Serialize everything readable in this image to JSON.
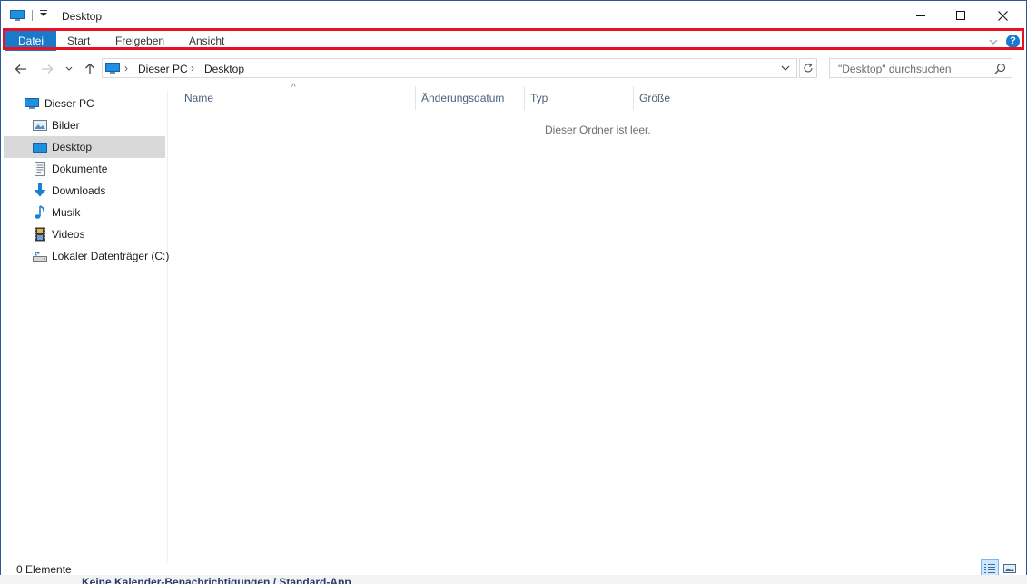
{
  "window": {
    "title": "Desktop"
  },
  "ribbon": {
    "tabs": [
      {
        "label": "Datei",
        "active": true
      },
      {
        "label": "Start"
      },
      {
        "label": "Freigeben"
      },
      {
        "label": "Ansicht"
      }
    ],
    "help_label": "?"
  },
  "navbar": {
    "breadcrumb": [
      "Dieser PC",
      "Desktop"
    ],
    "search_placeholder": "\"Desktop\" durchsuchen"
  },
  "sidebar": {
    "items": [
      {
        "label": "Dieser PC",
        "icon": "pc-icon"
      },
      {
        "label": "Bilder",
        "icon": "pictures-icon"
      },
      {
        "label": "Desktop",
        "icon": "desktop-icon",
        "selected": true
      },
      {
        "label": "Dokumente",
        "icon": "documents-icon"
      },
      {
        "label": "Downloads",
        "icon": "downloads-icon"
      },
      {
        "label": "Musik",
        "icon": "music-icon"
      },
      {
        "label": "Videos",
        "icon": "videos-icon"
      },
      {
        "label": "Lokaler Datenträger (C:)",
        "icon": "drive-icon"
      }
    ]
  },
  "content": {
    "columns": [
      "Name",
      "Änderungsdatum",
      "Typ",
      "Größe"
    ],
    "empty_message": "Dieser Ordner ist leer."
  },
  "status": {
    "item_count": "0 Elemente"
  },
  "background": {
    "partial_text": "Keine Kalender-Benachrichtigungen / Standard-App"
  },
  "colors": {
    "accent": "#1979ca",
    "highlight_outline": "#e81123",
    "selection": "#d9d9d9"
  }
}
